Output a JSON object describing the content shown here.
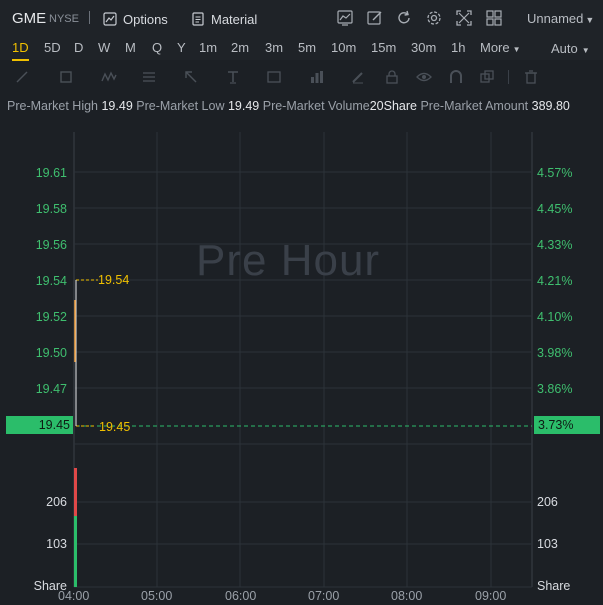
{
  "header": {
    "ticker": "GME",
    "exchange": "NYSE",
    "options_label": "Options",
    "material_label": "Material",
    "layout_name": "Unnamed",
    "icons": [
      "chart-style-icon",
      "draw-icon",
      "refresh-icon",
      "settings-icon",
      "fullscreen-icon",
      "grid-icon"
    ]
  },
  "periods": {
    "items": [
      "1D",
      "5D",
      "D",
      "W",
      "M",
      "Q",
      "Y",
      "1m",
      "2m",
      "3m",
      "5m",
      "10m",
      "15m",
      "30m",
      "1h"
    ],
    "active": "1D",
    "more_label": "More",
    "auto_label": "Auto"
  },
  "drawing_tools": [
    "line-tool-icon",
    "rect-tool-icon",
    "wave-tool-icon",
    "fib-tool-icon",
    "arrow-tool-icon",
    "text-tool-icon",
    "text-box-tool-icon",
    "measure-tool-icon",
    "pen-tool-icon",
    "lock-icon",
    "eye-icon",
    "magnet-icon",
    "copy-icon",
    "delete-icon"
  ],
  "info": {
    "high_label": "Pre-Market High",
    "high_value": "19.49",
    "low_label": "Pre-Market Low",
    "low_value": "19.49",
    "volume_label": "Pre-Market Volume",
    "volume_value": "20Share",
    "amount_label": "Pre-Market Amount",
    "amount_value": "389.80"
  },
  "chart": {
    "watermark": "Pre Hour",
    "price_ticks": [
      "19.61",
      "19.58",
      "19.56",
      "19.54",
      "19.52",
      "19.50",
      "19.47",
      "19.45"
    ],
    "percent_ticks": [
      "4.57%",
      "4.45%",
      "4.33%",
      "4.21%",
      "4.10%",
      "3.98%",
      "3.86%",
      "3.73%"
    ],
    "current_price": "19.45",
    "current_percent": "3.73%",
    "high_marker": "19.54",
    "low_marker": "19.45",
    "volume_ticks_left": [
      "206",
      "103",
      "Share"
    ],
    "volume_ticks_right": [
      "206",
      "103",
      "Share"
    ],
    "times": [
      "04:00",
      "05:00",
      "06:00",
      "07:00",
      "08:00",
      "09:00"
    ],
    "colors": {
      "up": "#2bbd6a",
      "down": "#e04848",
      "marker": "#f0c000",
      "grid": "#2c3239"
    }
  },
  "chart_data": {
    "type": "line",
    "title": "",
    "xlabel": "",
    "ylabel": "",
    "x": [
      "04:00",
      "05:00",
      "06:00",
      "07:00",
      "08:00",
      "09:00"
    ],
    "ylim": [
      19.44,
      19.62
    ],
    "series": [
      {
        "values": [
          19.54,
          19.45
        ]
      }
    ],
    "high": 19.54,
    "low": 19.45,
    "volume": [
      206,
      103
    ]
  }
}
